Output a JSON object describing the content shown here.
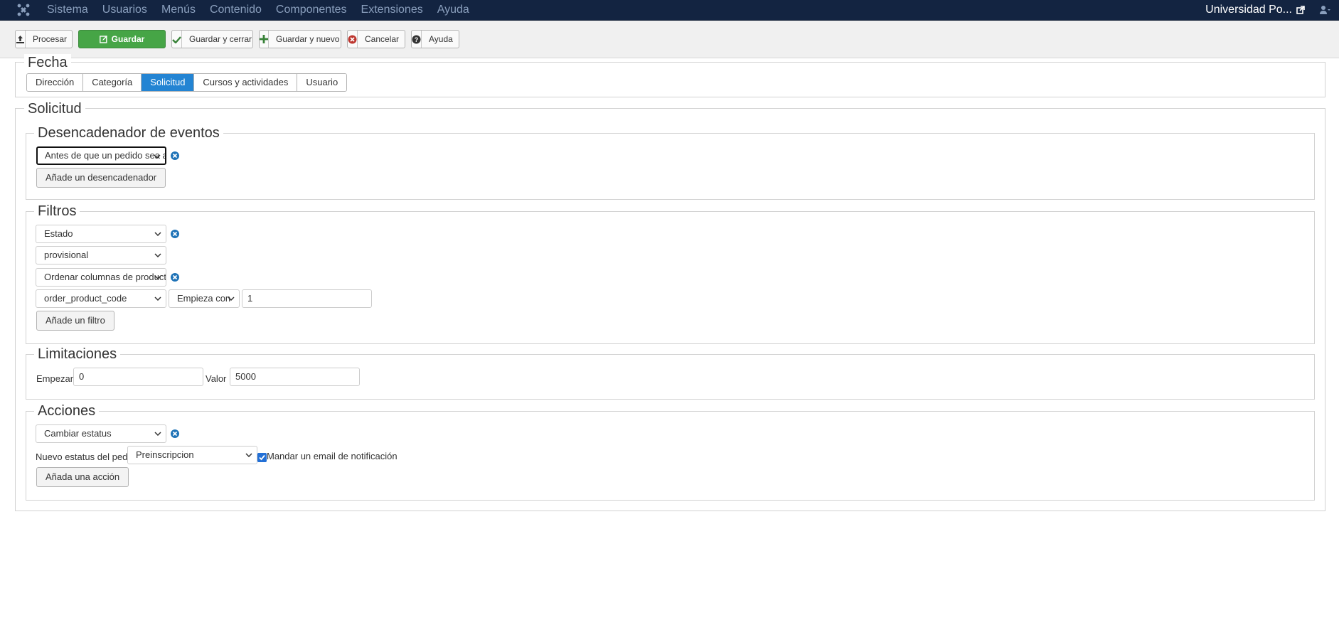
{
  "navbar": {
    "menu": [
      "Sistema",
      "Usuarios",
      "Menús",
      "Contenido",
      "Componentes",
      "Extensiones",
      "Ayuda"
    ],
    "site_name": "Universidad Po...",
    "logo_icon": "joomla-logo-icon",
    "external_icon": "external-link-icon",
    "user_icon": "user-icon"
  },
  "toolbar": {
    "procesar": "Procesar",
    "guardar": "Guardar",
    "guardar_cerrar": "Guardar y cerrar",
    "guardar_nuevo": "Guardar y nuevo",
    "cancelar": "Cancelar",
    "ayuda": "Ayuda"
  },
  "fecha": {
    "legend": "Fecha",
    "tabs": [
      "Dirección",
      "Categoría",
      "Solicitud",
      "Cursos y actividades",
      "Usuario"
    ],
    "active_tab": "Solicitud"
  },
  "solicitud": {
    "legend": "Solicitud",
    "trigger": {
      "legend": "Desencadenador de eventos",
      "select_value": "Antes de que un pedido sea actualizado",
      "add_button": "Añade un desencadenador"
    },
    "filters": {
      "legend": "Filtros",
      "filter1_value": "Estado",
      "filter1_sub_value": "provisional",
      "filter2_value": "Ordenar columnas de productos",
      "filter2_column": "order_product_code",
      "filter2_operator": "Empieza con",
      "filter2_input": "1",
      "add_button": "Añade un filtro"
    },
    "limits": {
      "legend": "Limitaciones",
      "start_label": "Empezar :",
      "start_value": "0",
      "value_label": "Valor :",
      "value_value": "5000"
    },
    "actions": {
      "legend": "Acciones",
      "action_value": "Cambiar estatus",
      "status_label": "Nuevo estatus del pedido:",
      "status_value": "Preinscripcion",
      "notify_label": "Mandar un email de notificación",
      "notify_checked": true,
      "add_button": "Añada una acción"
    }
  },
  "colors": {
    "navbar_bg": "#132441",
    "save_green": "#46a546",
    "active_tab_blue": "#2384d3",
    "remove_icon_blue": "#1f73b7"
  }
}
